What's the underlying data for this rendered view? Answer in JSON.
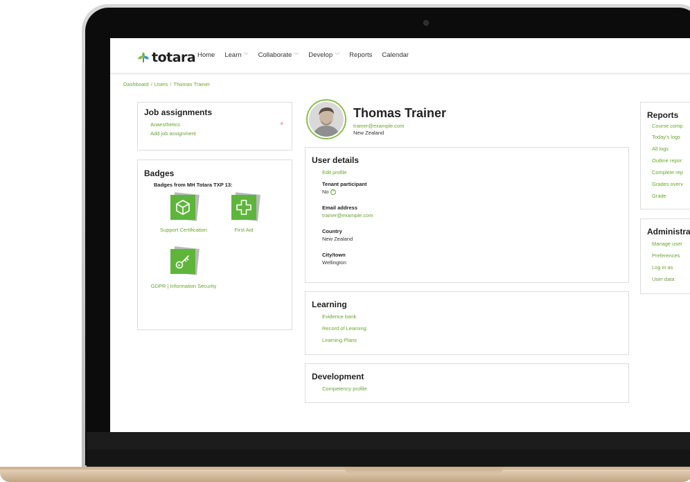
{
  "nav": {
    "logo": "totara",
    "items": [
      {
        "label": "Home",
        "dropdown": false
      },
      {
        "label": "Learn",
        "dropdown": true
      },
      {
        "label": "Collaborate",
        "dropdown": true
      },
      {
        "label": "Develop",
        "dropdown": true
      },
      {
        "label": "Reports",
        "dropdown": false
      },
      {
        "label": "Calendar",
        "dropdown": false
      }
    ]
  },
  "breadcrumb": [
    "Dashboard",
    "Users",
    "Thomas Trainer"
  ],
  "job_assignments": {
    "title": "Job assignments",
    "items": [
      "Anaesthetics"
    ],
    "add_label": "Add job assignment",
    "remove_glyph": "×"
  },
  "badges": {
    "title": "Badges",
    "subtitle": "Badges from MH Totara TXP 13:",
    "items": [
      {
        "name": "Support Certification",
        "icon": "cube-icon"
      },
      {
        "name": "First Aid",
        "icon": "first-aid-cross-icon"
      },
      {
        "name": "GDPR | Information Security",
        "icon": "key-icon"
      }
    ]
  },
  "profile": {
    "name": "Thomas Trainer",
    "email": "trainer@example.com",
    "country": "New Zealand"
  },
  "user_details": {
    "title": "User details",
    "edit_label": "Edit profile",
    "fields": [
      {
        "label": "Tenant participant",
        "value": "No"
      },
      {
        "label": "Email address",
        "value": "trainer@example.com"
      },
      {
        "label": "Country",
        "value": "New Zealand"
      },
      {
        "label": "City/town",
        "value": "Wellington"
      }
    ]
  },
  "learning": {
    "title": "Learning",
    "links": [
      "Evidence bank",
      "Record of Learning",
      "Learning Plans"
    ]
  },
  "development": {
    "title": "Development",
    "links": [
      "Competency profile"
    ]
  },
  "reports": {
    "title": "Reports",
    "links": [
      "Course comp",
      "Today's logs",
      "All logs",
      "Outline repor",
      "Complete rep",
      "Grades overv",
      "Grade"
    ]
  },
  "administration": {
    "title": "Administrat",
    "links": [
      "Manage user",
      "Preferences",
      "Log in as",
      "User data"
    ]
  },
  "colors": {
    "accent": "#69a431",
    "badge_green": "#5fb53b"
  }
}
